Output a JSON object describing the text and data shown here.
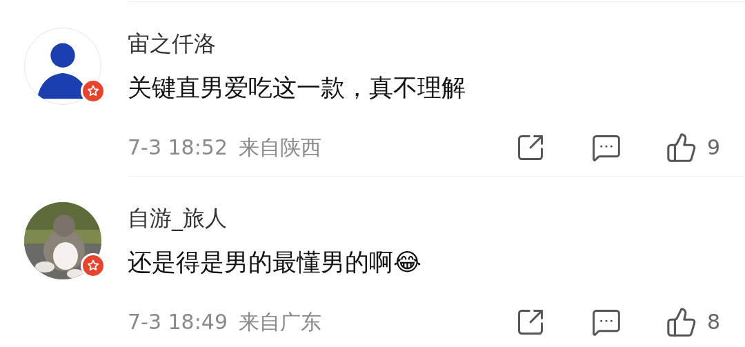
{
  "comments": [
    {
      "avatar": {
        "kind": "silhouette"
      },
      "verified": true,
      "username": "宙之仟洛",
      "text": "关键直男爱吃这一款，真不理解",
      "time": "7-3 18:52",
      "location": "来自陕西",
      "likes": "9"
    },
    {
      "verified": true,
      "username": "自游_旅人",
      "text": "还是得是男的最懂男的啊😂",
      "time": "7-3 18:49",
      "location": "来自广东",
      "likes": "8"
    }
  ]
}
